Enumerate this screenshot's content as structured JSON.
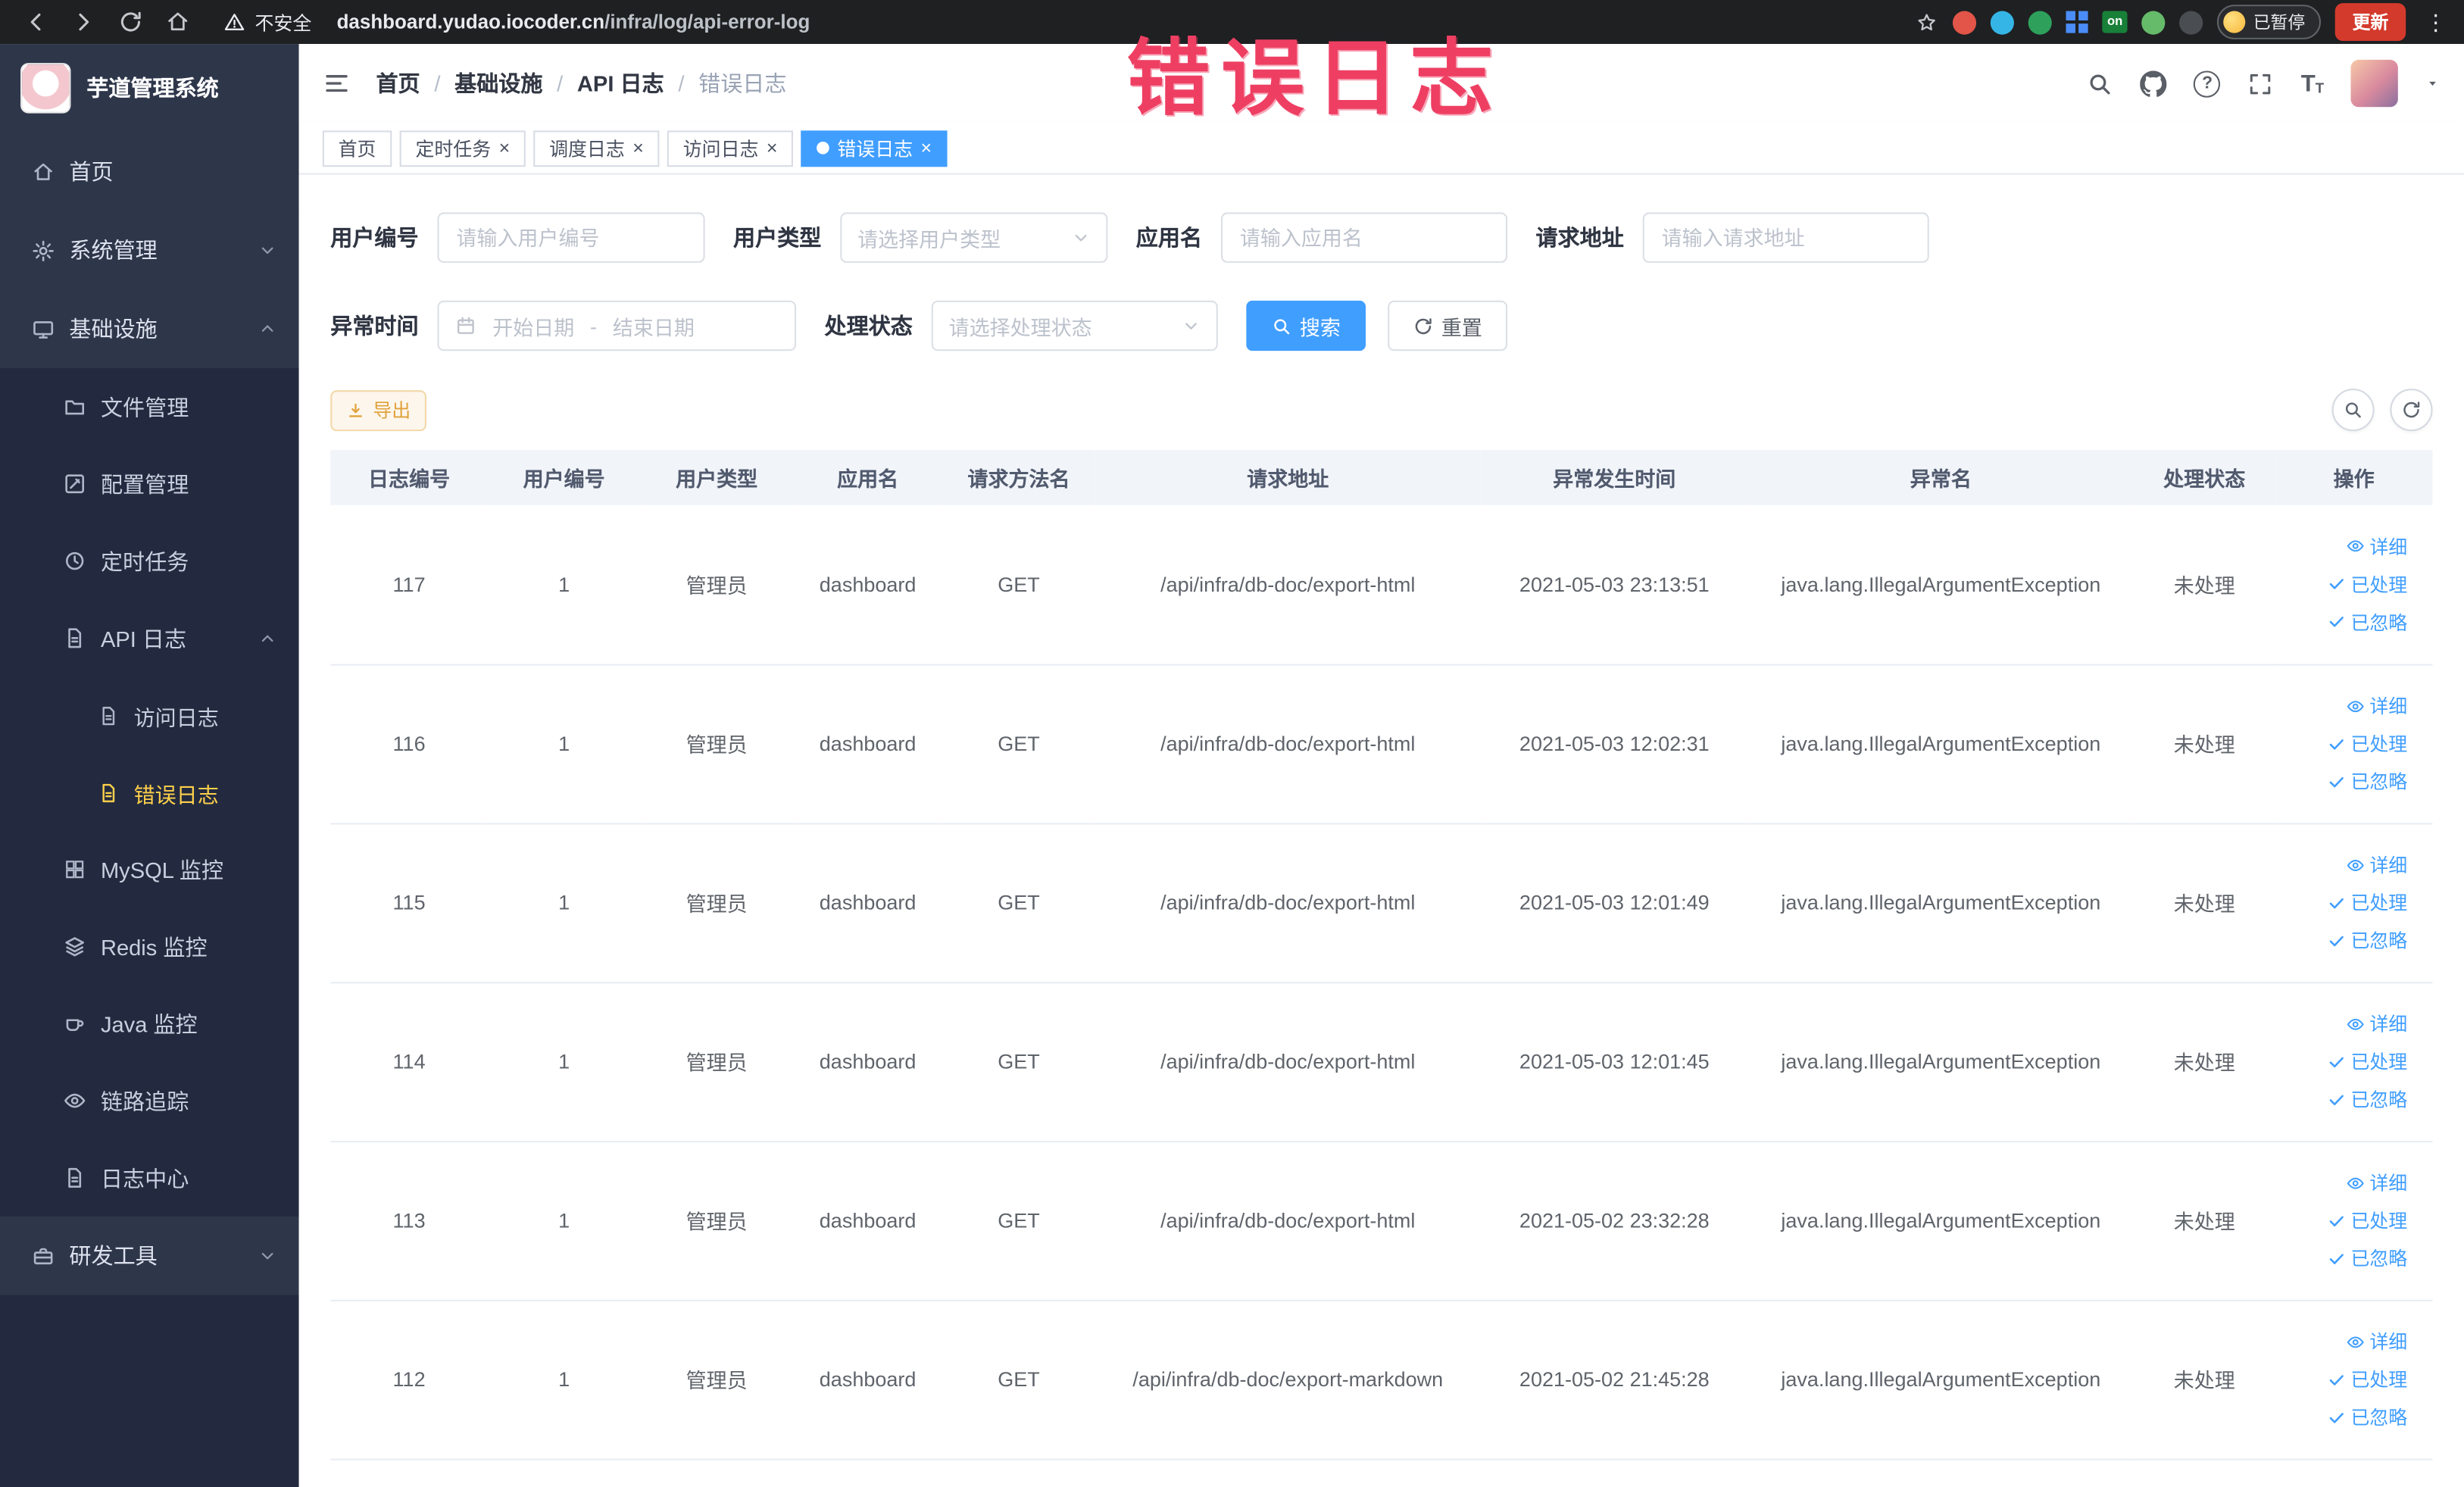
{
  "browser": {
    "security_label": "不安全",
    "url_domain": "dashboard.yudao.iocoder.cn",
    "url_path": "/infra/log/api-error-log",
    "extensions_badge": "on",
    "paused_badge": "已暂停",
    "update_button": "更新"
  },
  "icons": {
    "question": "?",
    "close": "×",
    "font_size": "T",
    "more_vert": "⋮"
  },
  "annotation": {
    "text": "错误日志"
  },
  "sidebar": {
    "logo_title": "芋道管理系统",
    "items": {
      "home": "首页",
      "system_mgmt": "系统管理",
      "infrastructure": "基础设施",
      "file_mgmt": "文件管理",
      "config_mgmt": "配置管理",
      "scheduled_jobs": "定时任务",
      "api_log": "API 日志",
      "access_log": "访问日志",
      "error_log": "错误日志",
      "mysql_monitor": "MySQL 监控",
      "redis_monitor": "Redis 监控",
      "java_monitor": "Java 监控",
      "link_trace": "链路追踪",
      "log_center": "日志中心",
      "dev_tools": "研发工具"
    }
  },
  "header": {
    "breadcrumb": [
      "首页",
      "基础设施",
      "API 日志",
      "错误日志"
    ],
    "separator": "/"
  },
  "tabs": [
    {
      "label": "首页"
    },
    {
      "label": "定时任务"
    },
    {
      "label": "调度日志"
    },
    {
      "label": "访问日志"
    },
    {
      "label": "错误日志"
    }
  ],
  "filters": {
    "user_id": {
      "label": "用户编号",
      "placeholder": "请输入用户编号"
    },
    "user_type": {
      "label": "用户类型",
      "placeholder": "请选择用户类型"
    },
    "app_name": {
      "label": "应用名",
      "placeholder": "请输入应用名"
    },
    "request_url": {
      "label": "请求地址",
      "placeholder": "请输入请求地址"
    },
    "exception_time": {
      "label": "异常时间",
      "start_placeholder": "开始日期",
      "separator": "-",
      "end_placeholder": "结束日期"
    },
    "process_status": {
      "label": "处理状态",
      "placeholder": "请选择处理状态"
    },
    "search_button": "搜索",
    "reset_button": "重置"
  },
  "toolbar": {
    "export_button": "导出"
  },
  "table": {
    "columns": [
      "日志编号",
      "用户编号",
      "用户类型",
      "应用名",
      "请求方法名",
      "请求地址",
      "异常发生时间",
      "异常名",
      "处理状态",
      "操作"
    ],
    "actions": {
      "detail": "详细",
      "processed": "已处理",
      "ignored": "已忽略"
    },
    "rows": [
      {
        "id": "117",
        "user_id": "1",
        "user_type": "管理员",
        "app_name": "dashboard",
        "method": "GET",
        "url": "/api/infra/db-doc/export-html",
        "time": "2021-05-03 23:13:51",
        "exception": "java.lang.IllegalArgumentException",
        "status": "未处理"
      },
      {
        "id": "116",
        "user_id": "1",
        "user_type": "管理员",
        "app_name": "dashboard",
        "method": "GET",
        "url": "/api/infra/db-doc/export-html",
        "time": "2021-05-03 12:02:31",
        "exception": "java.lang.IllegalArgumentException",
        "status": "未处理"
      },
      {
        "id": "115",
        "user_id": "1",
        "user_type": "管理员",
        "app_name": "dashboard",
        "method": "GET",
        "url": "/api/infra/db-doc/export-html",
        "time": "2021-05-03 12:01:49",
        "exception": "java.lang.IllegalArgumentException",
        "status": "未处理"
      },
      {
        "id": "114",
        "user_id": "1",
        "user_type": "管理员",
        "app_name": "dashboard",
        "method": "GET",
        "url": "/api/infra/db-doc/export-html",
        "time": "2021-05-03 12:01:45",
        "exception": "java.lang.IllegalArgumentException",
        "status": "未处理"
      },
      {
        "id": "113",
        "user_id": "1",
        "user_type": "管理员",
        "app_name": "dashboard",
        "method": "GET",
        "url": "/api/infra/db-doc/export-html",
        "time": "2021-05-02 23:32:28",
        "exception": "java.lang.IllegalArgumentException",
        "status": "未处理"
      },
      {
        "id": "112",
        "user_id": "1",
        "user_type": "管理员",
        "app_name": "dashboard",
        "method": "GET",
        "url": "/api/infra/db-doc/export-markdown",
        "time": "2021-05-02 21:45:28",
        "exception": "java.lang.IllegalArgumentException",
        "status": "未处理"
      }
    ]
  },
  "colors": {
    "primary": "#409eff",
    "sidebar_active_text": "#ffd04b",
    "annotation": "#ee3f63",
    "update_button": "#d33a2c"
  }
}
